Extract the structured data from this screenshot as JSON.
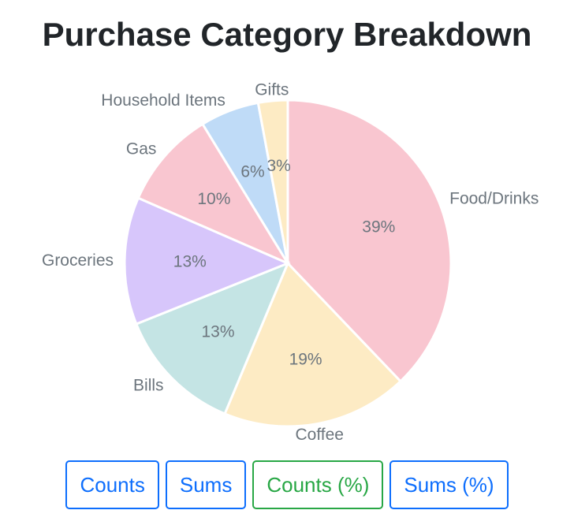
{
  "chart_data": {
    "type": "pie",
    "title": "Purchase Category Breakdown",
    "categories": [
      "Food/Drinks",
      "Coffee",
      "Bills",
      "Groceries",
      "Gas",
      "Household Items",
      "Gifts"
    ],
    "values": [
      39,
      19,
      13,
      13,
      10,
      6,
      3
    ],
    "value_labels": [
      "39%",
      "19%",
      "13%",
      "13%",
      "10%",
      "6%",
      "3%"
    ],
    "colors": [
      "#f9c6d0",
      "#fdebc4",
      "#c4e4e4",
      "#d7c6fb",
      "#f9c6d0",
      "#bfdbf7",
      "#fdebc4"
    ],
    "legend": "none"
  },
  "buttons": [
    {
      "label": "Counts",
      "active": false
    },
    {
      "label": "Sums",
      "active": false
    },
    {
      "label": "Counts (%)",
      "active": true
    },
    {
      "label": "Sums (%)",
      "active": false
    }
  ]
}
